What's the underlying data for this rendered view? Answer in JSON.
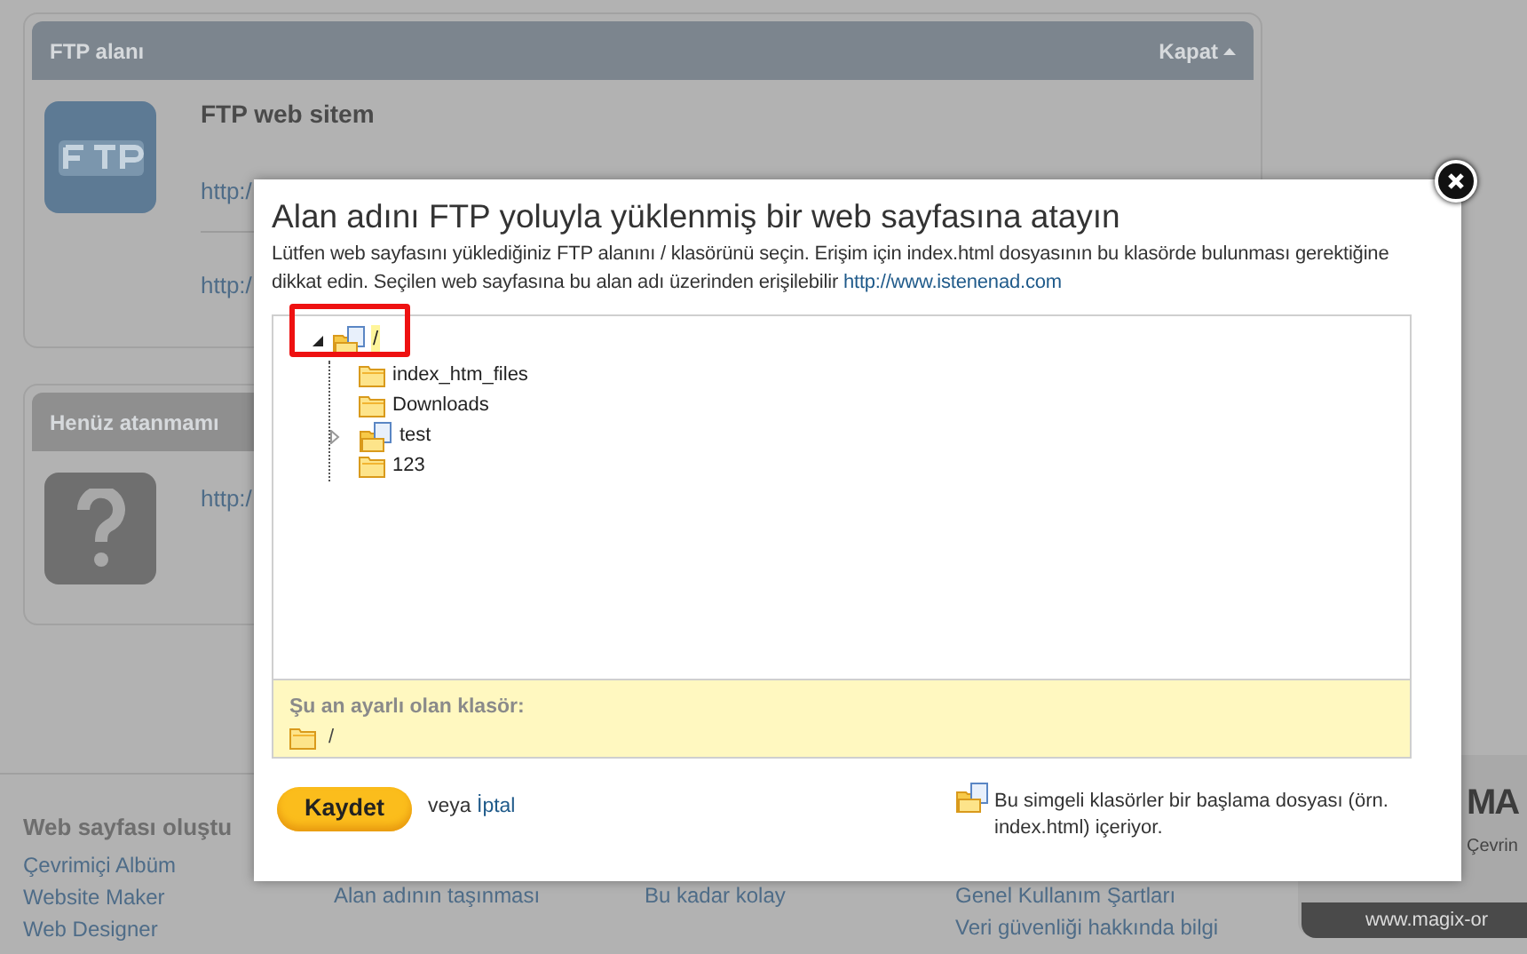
{
  "panels": [
    {
      "kind": "ftp",
      "title": "FTP alanı",
      "toggle": "Kapat",
      "site_title": "FTP web sitem",
      "links": [
        "http:/",
        "http:/"
      ]
    },
    {
      "kind": "unknown",
      "title": "Henüz atanmamı",
      "links": [
        "http:/"
      ]
    }
  ],
  "footer": {
    "heading": "Web sayfası oluştu",
    "columns": [
      [
        "Çevrimiçi Albüm",
        "Website Maker",
        "Web Designer"
      ],
      [
        "Alan adının taşınması"
      ],
      [
        "Bu kadar kolay"
      ],
      [
        "Genel Kullanım Şartları",
        "Veri güvenliği hakkında bilgi"
      ]
    ]
  },
  "ad": {
    "logo": "MA",
    "tagline": "Çevrin",
    "url": "www.magix-or"
  },
  "dialog": {
    "title": "Alan adını FTP yoluyla yüklenmiş bir web sayfasına atayın",
    "description": "Lütfen web sayfasını yüklediğiniz FTP alanını / klasörünü seçin. Erişim için index.html dosyasının bu klasörde bulunması gerektiğine dikkat edin. Seçilen web sayfasına bu alan adı üzerinden erişilebilir",
    "description_link": "http://www.istenenad.com",
    "tree": {
      "label": "/",
      "selected": true,
      "expanded": true,
      "has_start_file": true,
      "children": [
        {
          "label": "index_htm_files",
          "selected": false,
          "has_start_file": false
        },
        {
          "label": "Downloads",
          "selected": false,
          "has_start_file": false
        },
        {
          "label": "test",
          "selected": false,
          "expanded": false,
          "has_start_file": true
        },
        {
          "label": "123",
          "selected": false,
          "has_start_file": false
        }
      ]
    },
    "current_folder": {
      "label": "Şu an ayarlı olan klasör:",
      "value": "/"
    },
    "save_button": "Kaydet",
    "or_text": "veya",
    "cancel_link": "İptal",
    "legend": "Bu simgeli klasörler bir başlama dosyası (örn. index.html) içeriyor."
  }
}
